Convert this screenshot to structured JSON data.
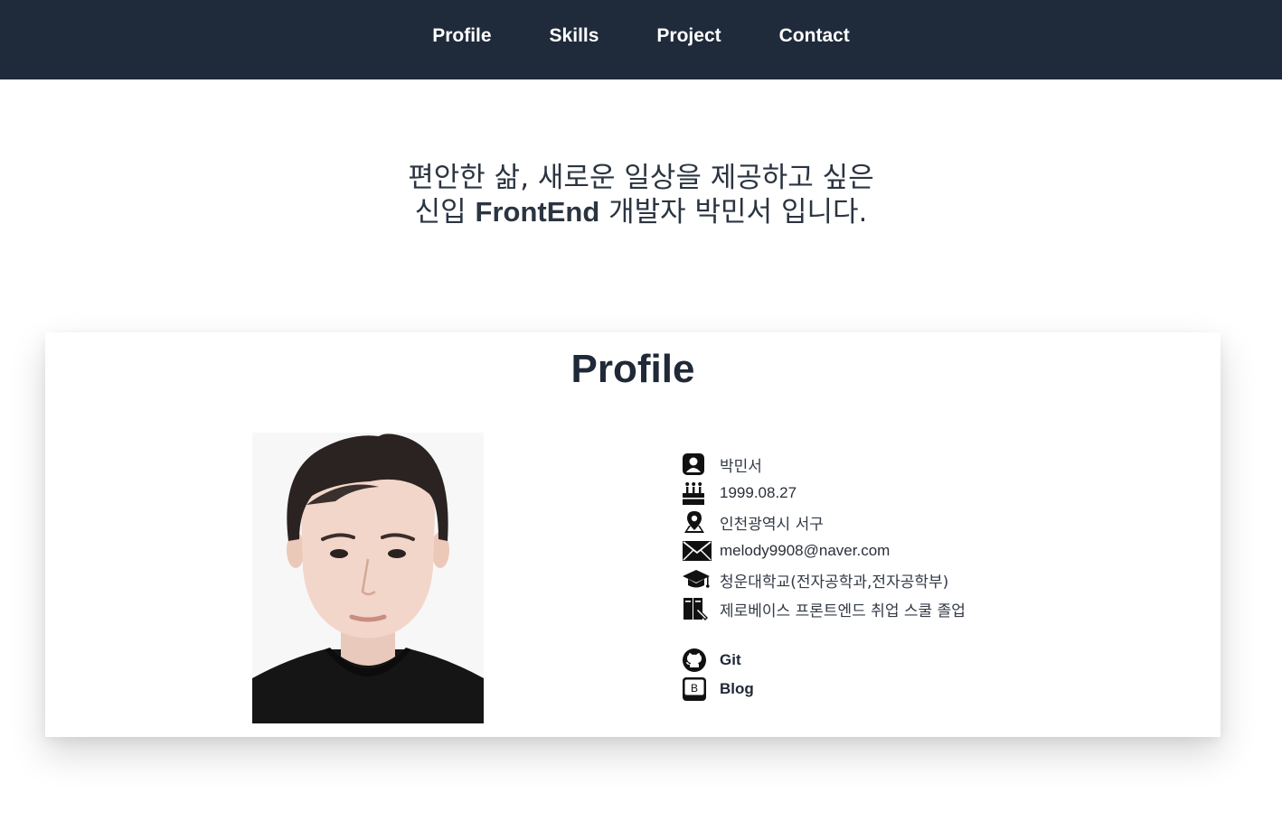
{
  "nav": {
    "items": [
      {
        "label": "Profile"
      },
      {
        "label": "Skills"
      },
      {
        "label": "Project"
      },
      {
        "label": "Contact"
      }
    ]
  },
  "intro": {
    "line1": "편안한 삶, 새로운 일상을 제공하고 싶은",
    "line2_prefix": "신입 ",
    "line2_highlight": "FrontEnd",
    "line2_suffix": " 개발자 박민서 입니다."
  },
  "profile": {
    "title": "Profile",
    "info": {
      "name": "박민서",
      "birthday": "1999.08.27",
      "location": "인천광역시 서구",
      "email": "melody9908@naver.com",
      "education": "청운대학교(전자공학과,전자공학부)",
      "course": "제로베이스 프론트엔드 취업 스쿨 졸업"
    },
    "links": {
      "git": "Git",
      "blog": "Blog",
      "blog_icon_letter": "B"
    }
  },
  "colors": {
    "nav_bg": "#1f2a3a",
    "text_dark": "#1f2937"
  },
  "icons": [
    "user-icon",
    "cake-icon",
    "map-pin-icon",
    "mail-icon",
    "graduation-cap-icon",
    "book-icon",
    "github-icon",
    "blog-icon"
  ]
}
